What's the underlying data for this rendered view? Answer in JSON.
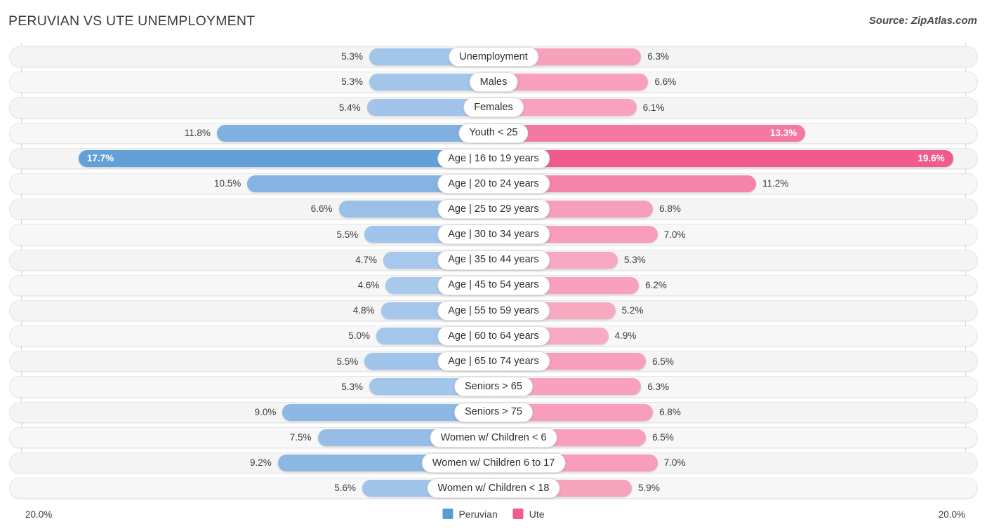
{
  "header": {
    "title": "PERUVIAN VS UTE UNEMPLOYMENT",
    "source": "Source: ZipAtlas.com"
  },
  "footer": {
    "axis_min_left": "20.0%",
    "axis_min_right": "20.0%",
    "legend": [
      {
        "label": "Peruvian",
        "color": "#5B9BD5"
      },
      {
        "label": "Ute",
        "color": "#F05A8F"
      }
    ]
  },
  "colors": {
    "left_min": "#A8C8EC",
    "left_max": "#5B9BD5",
    "right_min": "#F9AEC5",
    "right_max": "#F05A8F",
    "track": "#f4f4f4",
    "axis": "#d9d9d9",
    "text": "#3d3d3d"
  },
  "chart_data": {
    "type": "bar",
    "subtype": "diverging-butterfly",
    "title": "PERUVIAN VS UTE UNEMPLOYMENT",
    "xlabel": "",
    "ylabel": "",
    "xlim": [
      20.0,
      20.0
    ],
    "axis_max": 20.0,
    "unit": "%",
    "grid": false,
    "legend_position": "bottom-center",
    "categories": [
      "Unemployment",
      "Males",
      "Females",
      "Youth < 25",
      "Age | 16 to 19 years",
      "Age | 20 to 24 years",
      "Age | 25 to 29 years",
      "Age | 30 to 34 years",
      "Age | 35 to 44 years",
      "Age | 45 to 54 years",
      "Age | 55 to 59 years",
      "Age | 60 to 64 years",
      "Age | 65 to 74 years",
      "Seniors > 65",
      "Seniors > 75",
      "Women w/ Children < 6",
      "Women w/ Children 6 to 17",
      "Women w/ Children < 18"
    ],
    "series": [
      {
        "name": "Peruvian",
        "side": "left",
        "color": "#5B9BD5",
        "values": [
          5.3,
          5.3,
          5.4,
          11.8,
          17.7,
          10.5,
          6.6,
          5.5,
          4.7,
          4.6,
          4.8,
          5.0,
          5.5,
          5.3,
          9.0,
          7.5,
          9.2,
          5.6
        ],
        "labels": [
          "5.3%",
          "5.3%",
          "5.4%",
          "11.8%",
          "17.7%",
          "10.5%",
          "6.6%",
          "5.5%",
          "4.7%",
          "4.6%",
          "4.8%",
          "5.0%",
          "5.5%",
          "5.3%",
          "9.0%",
          "7.5%",
          "9.2%",
          "5.6%"
        ]
      },
      {
        "name": "Ute",
        "side": "right",
        "color": "#F05A8F",
        "values": [
          6.3,
          6.6,
          6.1,
          13.3,
          19.6,
          11.2,
          6.8,
          7.0,
          5.3,
          6.2,
          5.2,
          4.9,
          6.5,
          6.3,
          6.8,
          6.5,
          7.0,
          5.9
        ],
        "labels": [
          "6.3%",
          "6.6%",
          "6.1%",
          "13.3%",
          "19.6%",
          "11.2%",
          "6.8%",
          "7.0%",
          "5.3%",
          "6.2%",
          "5.2%",
          "4.9%",
          "6.5%",
          "6.3%",
          "6.8%",
          "6.5%",
          "7.0%",
          "5.9%"
        ]
      }
    ]
  },
  "rows": [
    {
      "label": "Unemployment",
      "left": "5.3%",
      "right": "6.3%",
      "left_val": 5.3,
      "right_val": 6.3,
      "left_inside": false,
      "right_inside": false
    },
    {
      "label": "Males",
      "left": "5.3%",
      "right": "6.6%",
      "left_val": 5.3,
      "right_val": 6.6,
      "left_inside": false,
      "right_inside": false
    },
    {
      "label": "Females",
      "left": "5.4%",
      "right": "6.1%",
      "left_val": 5.4,
      "right_val": 6.1,
      "left_inside": false,
      "right_inside": false
    },
    {
      "label": "Youth < 25",
      "left": "11.8%",
      "right": "13.3%",
      "left_val": 11.8,
      "right_val": 13.3,
      "left_inside": false,
      "right_inside": true
    },
    {
      "label": "Age | 16 to 19 years",
      "left": "17.7%",
      "right": "19.6%",
      "left_val": 17.7,
      "right_val": 19.6,
      "left_inside": true,
      "right_inside": true
    },
    {
      "label": "Age | 20 to 24 years",
      "left": "10.5%",
      "right": "11.2%",
      "left_val": 10.5,
      "right_val": 11.2,
      "left_inside": false,
      "right_inside": false
    },
    {
      "label": "Age | 25 to 29 years",
      "left": "6.6%",
      "right": "6.8%",
      "left_val": 6.6,
      "right_val": 6.8,
      "left_inside": false,
      "right_inside": false
    },
    {
      "label": "Age | 30 to 34 years",
      "left": "5.5%",
      "right": "7.0%",
      "left_val": 5.5,
      "right_val": 7.0,
      "left_inside": false,
      "right_inside": false
    },
    {
      "label": "Age | 35 to 44 years",
      "left": "4.7%",
      "right": "5.3%",
      "left_val": 4.7,
      "right_val": 5.3,
      "left_inside": false,
      "right_inside": false
    },
    {
      "label": "Age | 45 to 54 years",
      "left": "4.6%",
      "right": "6.2%",
      "left_val": 4.6,
      "right_val": 6.2,
      "left_inside": false,
      "right_inside": false
    },
    {
      "label": "Age | 55 to 59 years",
      "left": "4.8%",
      "right": "5.2%",
      "left_val": 4.8,
      "right_val": 5.2,
      "left_inside": false,
      "right_inside": false
    },
    {
      "label": "Age | 60 to 64 years",
      "left": "5.0%",
      "right": "4.9%",
      "left_val": 5.0,
      "right_val": 4.9,
      "left_inside": false,
      "right_inside": false
    },
    {
      "label": "Age | 65 to 74 years",
      "left": "5.5%",
      "right": "6.5%",
      "left_val": 5.5,
      "right_val": 6.5,
      "left_inside": false,
      "right_inside": false
    },
    {
      "label": "Seniors > 65",
      "left": "5.3%",
      "right": "6.3%",
      "left_val": 5.3,
      "right_val": 6.3,
      "left_inside": false,
      "right_inside": false
    },
    {
      "label": "Seniors > 75",
      "left": "9.0%",
      "right": "6.8%",
      "left_val": 9.0,
      "right_val": 6.8,
      "left_inside": false,
      "right_inside": false
    },
    {
      "label": "Women w/ Children < 6",
      "left": "7.5%",
      "right": "6.5%",
      "left_val": 7.5,
      "right_val": 6.5,
      "left_inside": false,
      "right_inside": false
    },
    {
      "label": "Women w/ Children 6 to 17",
      "left": "9.2%",
      "right": "7.0%",
      "left_val": 9.2,
      "right_val": 7.0,
      "left_inside": false,
      "right_inside": false
    },
    {
      "label": "Women w/ Children < 18",
      "left": "5.6%",
      "right": "5.9%",
      "left_val": 5.6,
      "right_val": 5.9,
      "left_inside": false,
      "right_inside": false
    }
  ]
}
